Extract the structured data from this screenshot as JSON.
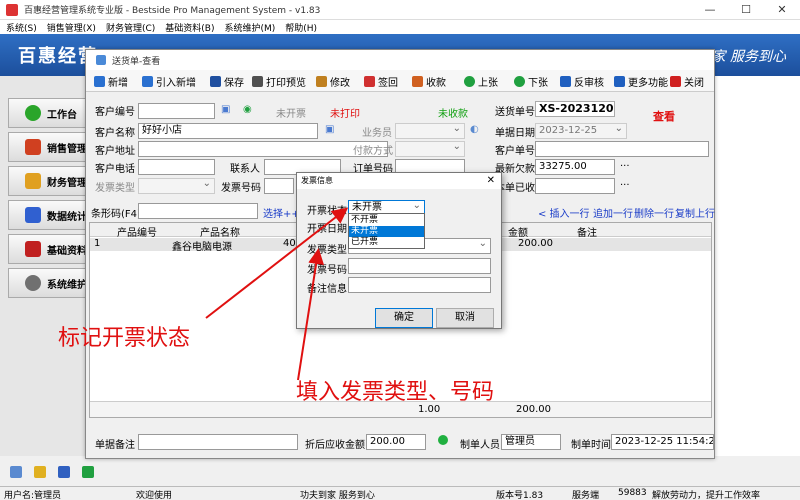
{
  "app": {
    "title": "百惠经营管理系统专业版 - Bestside Pro Management System - v1.83",
    "window_controls": [
      "—",
      "☐",
      "✕"
    ]
  },
  "menu": [
    "系统(S)",
    "销售管理(X)",
    "财务管理(C)",
    "基础资料(B)",
    "系统维护(M)",
    "帮助(H)"
  ],
  "banner": {
    "brand": "百惠经营",
    "slogan": "家 服务到心"
  },
  "nav": [
    {
      "label": "工作台",
      "icon": "check-icon",
      "color": "#2aa52a"
    },
    {
      "label": "销售管理",
      "icon": "house-icon",
      "color": "#d04020"
    },
    {
      "label": "财务管理",
      "icon": "gears-icon",
      "color": "#e0a020"
    },
    {
      "label": "数据统计",
      "icon": "chart-icon",
      "color": "#3060d0"
    },
    {
      "label": "基础资料",
      "icon": "folder-icon",
      "color": "#c02020"
    },
    {
      "label": "系统维护",
      "icon": "cog-icon",
      "color": "#707070"
    }
  ],
  "doc": {
    "title": "送货单-查看",
    "toolbar": [
      {
        "label": "新增",
        "icon": "plus-icon",
        "color": "#2a70d0"
      },
      {
        "label": "引入新增",
        "icon": "import-icon",
        "color": "#2a70d0"
      },
      {
        "label": "保存",
        "icon": "save-icon",
        "color": "#2050a0"
      },
      {
        "label": "打印预览",
        "icon": "print-icon",
        "color": "#505050"
      },
      {
        "label": "修改",
        "icon": "edit-icon",
        "color": "#c08020"
      },
      {
        "label": "签回",
        "icon": "sign-icon",
        "color": "#d03030"
      },
      {
        "label": "收款",
        "icon": "money-icon",
        "color": "#d06020"
      },
      {
        "label": "上张",
        "icon": "up-icon",
        "color": "#20a040"
      },
      {
        "label": "下张",
        "icon": "down-icon",
        "color": "#20a040"
      },
      {
        "label": "反审核",
        "icon": "unaudit-icon",
        "color": "#2060c0"
      },
      {
        "label": "更多功能",
        "icon": "more-icon",
        "color": "#2060c0"
      },
      {
        "label": "关闭",
        "icon": "close-icon",
        "color": "#d02020"
      }
    ],
    "labels": {
      "customer_no": "客户编号",
      "customer_name": "客户名称",
      "customer_addr": "客户地址",
      "customer_phone": "客户电话",
      "contact": "联系人",
      "invoice_type": "发票类型",
      "invoice_no": "发票号码",
      "salesman": "业务员",
      "payment": "付款方式",
      "order_no": "订单号码",
      "delivery_no": "送货单号",
      "doc_date": "单据日期",
      "cust_doc_no": "客户单号",
      "latest_debt": "最新欠款",
      "this_paid": "本单已收",
      "barcode": "条形码(F4)",
      "select": "选择++",
      "remark": "单据备注",
      "discount_received": "折后应收金额",
      "maker": "制单人员",
      "make_time": "制单时间"
    },
    "status": {
      "invoice": "未开票",
      "print": "未打印",
      "payment": "未收款",
      "review": "查看"
    },
    "values": {
      "customer_name": "好好小店",
      "delivery_no": "XS-202312009",
      "doc_date": "2023-12-25",
      "latest_debt": "33275.00",
      "discount_received": "200.00",
      "maker": "管理员",
      "make_time": "2023-12-25 11:54:26"
    },
    "row_actions": [
      "< 插入一行",
      "追加一行",
      "删除一行",
      "复制上行"
    ],
    "grid": {
      "headers": [
        "产品编号",
        "产品名称",
        "金额",
        "备注"
      ],
      "rows": [
        {
          "idx": "1",
          "name": "鑫谷电脑电源",
          "spec": "400W",
          "amount": "200.00"
        }
      ],
      "foot_qty": "1.00",
      "foot_amount": "200.00"
    }
  },
  "dialog": {
    "title": "发票信息",
    "labels": {
      "status": "开票状态",
      "date": "开票日期",
      "type": "发票类型",
      "no": "发票号码",
      "note": "备注信息"
    },
    "status_value": "未开票",
    "options": [
      "不开票",
      "未开票",
      "已开票"
    ],
    "ok": "确定",
    "cancel": "取消"
  },
  "annotations": {
    "mark": "标记开票状态",
    "fill": "填入发票类型、号码"
  },
  "statusbar": {
    "user": "用户名:管理员",
    "welcome": "欢迎使用",
    "motto": "功夫到家 服务到心",
    "version": "版本号1.83",
    "server": "服务端",
    "number": "59883",
    "ad": "解放劳动力，提升工作效率"
  }
}
